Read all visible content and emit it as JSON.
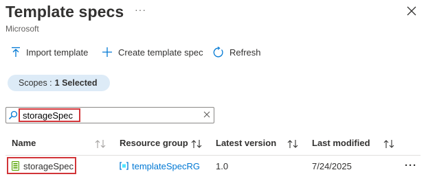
{
  "header": {
    "title": "Template specs",
    "subtitle": "Microsoft",
    "more": "···"
  },
  "toolbar": {
    "import_label": "Import template",
    "create_label": "Create template spec",
    "refresh_label": "Refresh"
  },
  "filter": {
    "scopes_label": "Scopes :",
    "scopes_value": "1 Selected",
    "search_value": "storageSpec"
  },
  "table": {
    "columns": [
      "Name",
      "Resource group",
      "Latest version",
      "Last modified"
    ],
    "rows": [
      {
        "name": "storageSpec",
        "resource_group": "templateSpecRG",
        "latest_version": "1.0",
        "last_modified": "7/24/2025",
        "more": "···"
      }
    ]
  },
  "colors": {
    "accent": "#0078d4",
    "highlight": "#d13438",
    "scope_pill": "#ddebf7"
  },
  "icons": {
    "import": "upload-arrow-icon",
    "create": "plus-icon",
    "refresh": "refresh-icon",
    "search": "search-icon",
    "clear": "close-icon",
    "template_spec": "template-spec-icon",
    "resource_group": "resource-group-icon",
    "sort": "sort-icon"
  }
}
